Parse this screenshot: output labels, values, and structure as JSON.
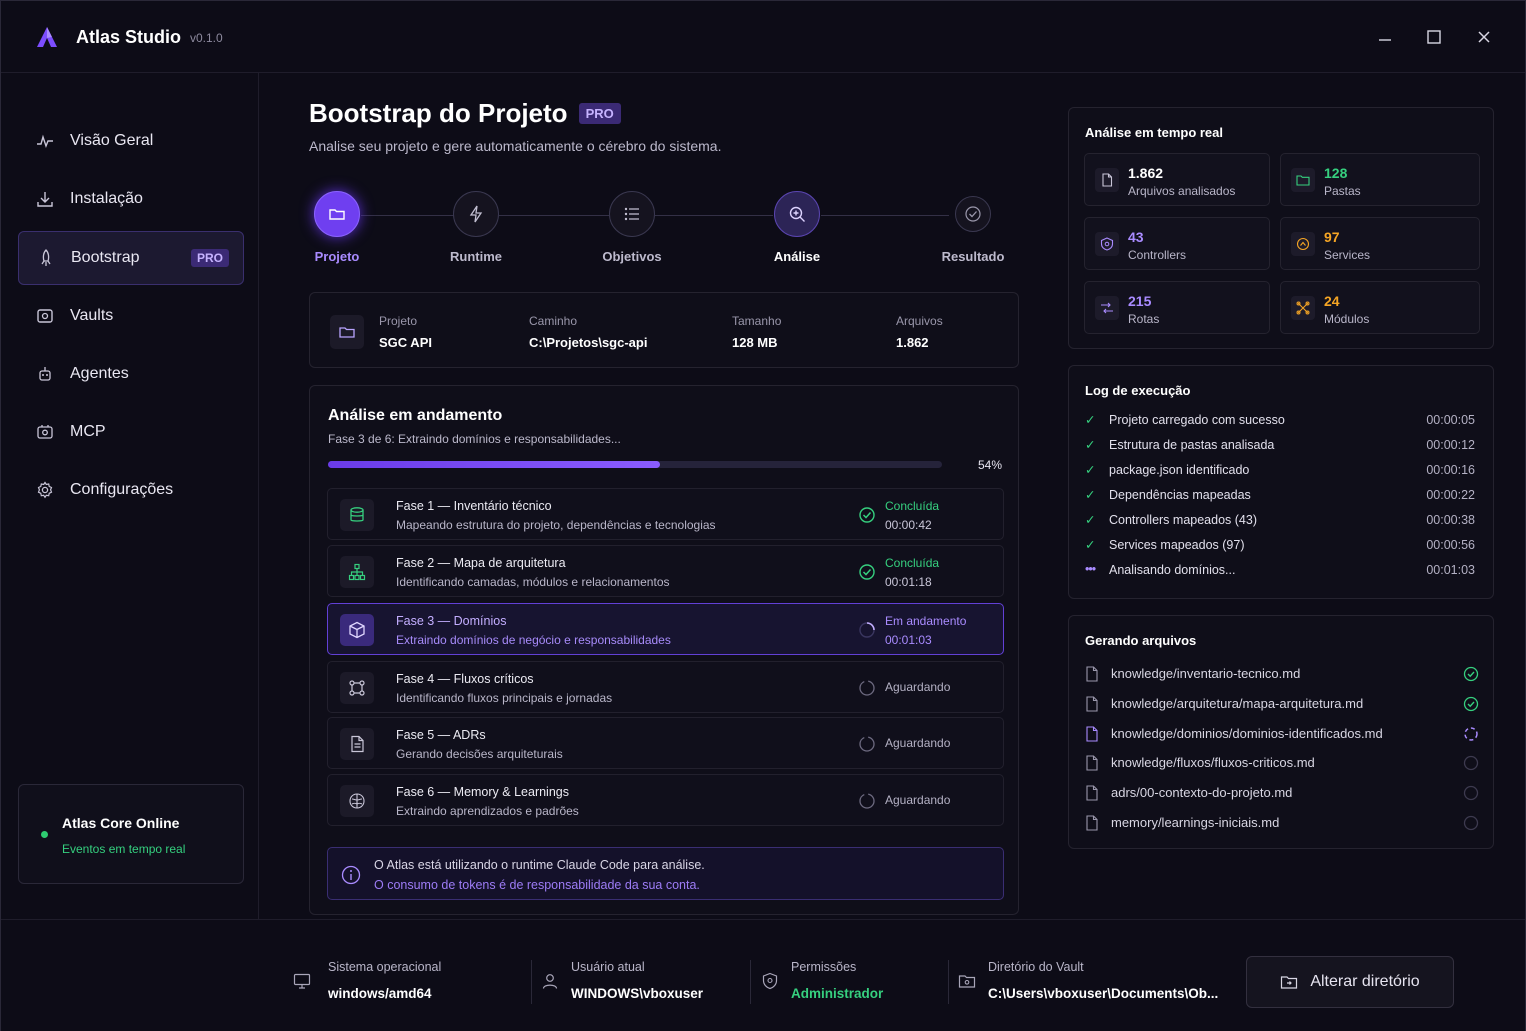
{
  "app": {
    "title": "Atlas Studio",
    "version": "v0.1.0"
  },
  "sidebar": {
    "items": [
      {
        "label": "Visão Geral",
        "icon": "activity-icon"
      },
      {
        "label": "Instalação",
        "icon": "download-icon"
      },
      {
        "label": "Bootstrap",
        "icon": "rocket-icon",
        "badge": "PRO",
        "active": true
      },
      {
        "label": "Vaults",
        "icon": "vault-icon"
      },
      {
        "label": "Agentes",
        "icon": "agents-icon"
      },
      {
        "label": "MCP",
        "icon": "mcp-icon"
      },
      {
        "label": "Configurações",
        "icon": "gear-icon"
      }
    ],
    "core": {
      "title": "Atlas Core Online",
      "subtitle": "Eventos em tempo real"
    }
  },
  "main": {
    "title": "Bootstrap do Projeto",
    "badge": "PRO",
    "subtitle": "Analise seu projeto e gere automaticamente o cérebro do sistema.",
    "steps": [
      {
        "label": "Projeto",
        "state": "active"
      },
      {
        "label": "Runtime",
        "state": "idle"
      },
      {
        "label": "Objetivos",
        "state": "idle"
      },
      {
        "label": "Análise",
        "state": "current"
      },
      {
        "label": "Resultado",
        "state": "idle"
      }
    ],
    "project": {
      "name_label": "Projeto",
      "name": "SGC API",
      "path_label": "Caminho",
      "path": "C:\\Projetos\\sgc-api",
      "size_label": "Tamanho",
      "size": "128 MB",
      "files_label": "Arquivos",
      "files": "1.862"
    },
    "analysis": {
      "title": "Análise em andamento",
      "subtitle": "Fase 3 de 6: Extraindo domínios e responsabilidades...",
      "progress": 54,
      "progress_label": "54%",
      "phases": [
        {
          "title": "Fase 1 — Inventário técnico",
          "desc": "Mapeando estrutura do projeto, dependências e tecnologias",
          "status": "Concluída",
          "time": "00:00:42",
          "state": "done"
        },
        {
          "title": "Fase 2 — Mapa de arquitetura",
          "desc": "Identificando camadas, módulos e relacionamentos",
          "status": "Concluída",
          "time": "00:01:18",
          "state": "done"
        },
        {
          "title": "Fase 3 — Domínios",
          "desc": "Extraindo domínios de negócio e responsabilidades",
          "status": "Em andamento",
          "time": "00:01:03",
          "state": "current"
        },
        {
          "title": "Fase 4 — Fluxos críticos",
          "desc": "Identificando fluxos principais e jornadas",
          "status": "Aguardando",
          "time": "",
          "state": "wait"
        },
        {
          "title": "Fase 5 — ADRs",
          "desc": "Gerando decisões arquiteturais",
          "status": "Aguardando",
          "time": "",
          "state": "wait"
        },
        {
          "title": "Fase 6 — Memory & Learnings",
          "desc": "Extraindo aprendizados e padrões",
          "status": "Aguardando",
          "time": "",
          "state": "wait"
        }
      ],
      "info_line1": "O Atlas está utilizando o runtime Claude Code para análise.",
      "info_line2": "O consumo de tokens é de responsabilidade da sua conta."
    }
  },
  "realtime": {
    "title": "Análise em tempo real",
    "stats": [
      {
        "value": "1.862",
        "label": "Arquivos analisados",
        "color": "#ffffff"
      },
      {
        "value": "128",
        "label": "Pastas",
        "color": "#36d07f"
      },
      {
        "value": "43",
        "label": "Controllers",
        "color": "#a98bff"
      },
      {
        "value": "97",
        "label": "Services",
        "color": "#f5a524"
      },
      {
        "value": "215",
        "label": "Rotas",
        "color": "#a98bff"
      },
      {
        "value": "24",
        "label": "Módulos",
        "color": "#f5a524"
      }
    ]
  },
  "log": {
    "title": "Log de execução",
    "entries": [
      {
        "text": "Projeto carregado com sucesso",
        "time": "00:00:05"
      },
      {
        "text": "Estrutura de pastas analisada",
        "time": "00:00:12"
      },
      {
        "text": "package.json identificado",
        "time": "00:00:16"
      },
      {
        "text": "Dependências mapeadas",
        "time": "00:00:22"
      },
      {
        "text": "Controllers mapeados (43)",
        "time": "00:00:38"
      },
      {
        "text": "Services mapeados (97)",
        "time": "00:00:56"
      },
      {
        "text": "Analisando domínios...",
        "time": "00:01:03"
      }
    ]
  },
  "files": {
    "title": "Gerando arquivos",
    "items": [
      {
        "name": "knowledge/inventario-tecnico.md",
        "state": "done"
      },
      {
        "name": "knowledge/arquitetura/mapa-arquitetura.md",
        "state": "done"
      },
      {
        "name": "knowledge/dominios/dominios-identificados.md",
        "state": "running"
      },
      {
        "name": "knowledge/fluxos/fluxos-criticos.md",
        "state": "pending"
      },
      {
        "name": "adrs/00-contexto-do-projeto.md",
        "state": "pending"
      },
      {
        "name": "memory/learnings-iniciais.md",
        "state": "pending"
      }
    ]
  },
  "footer": {
    "os_label": "Sistema operacional",
    "os": "windows/amd64",
    "user_label": "Usuário atual",
    "user": "WINDOWS\\vboxuser",
    "perm_label": "Permissões",
    "perm": "Administrador",
    "vault_label": "Diretório do Vault",
    "vault": "C:\\Users\\vboxuser\\Documents\\Ob...",
    "button": "Alterar diretório"
  },
  "colors": {
    "accent": "#6f3ff0",
    "success": "#36d07f",
    "warning": "#f5a524"
  }
}
